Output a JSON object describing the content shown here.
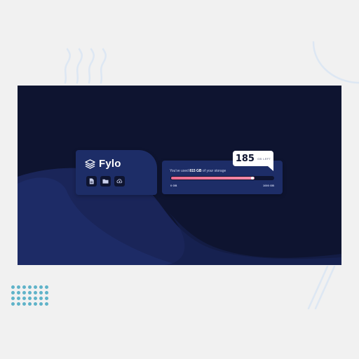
{
  "app": {
    "brand_name": "Fylo",
    "logo_icon": "layers-logo-icon"
  },
  "toolbar": {
    "buttons": [
      {
        "name": "document",
        "icon": "document-icon"
      },
      {
        "name": "folder",
        "icon": "folder-icon"
      },
      {
        "name": "upload",
        "icon": "cloud-upload-icon"
      }
    ]
  },
  "storage": {
    "usage_prefix": "You've used ",
    "used_amount": "815 GB",
    "usage_suffix": " of your storage",
    "used_fraction": 0.815,
    "min_label": "0 GB",
    "max_label": "1000 GB",
    "remaining_number": "185",
    "remaining_unit": "GB LEFT"
  },
  "colors": {
    "background": "#0e1430",
    "card": "#1d2d67",
    "accent_start": "#e96a8e",
    "accent_end": "#f58ba9",
    "dots": "#5fb3c9"
  }
}
